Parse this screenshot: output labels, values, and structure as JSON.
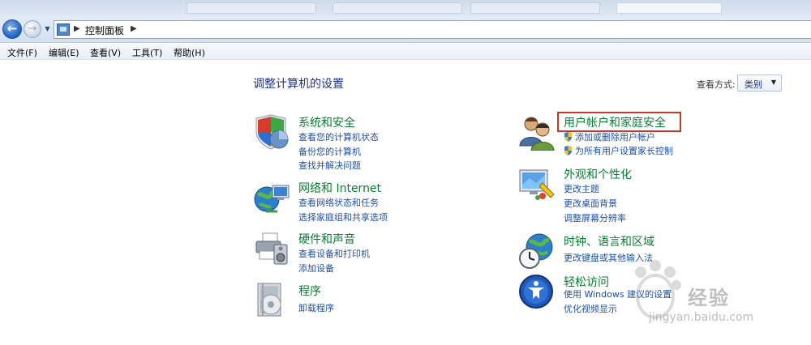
{
  "address": {
    "crumb": "控制面板"
  },
  "menu": {
    "file": "文件(F)",
    "edit": "编辑(E)",
    "view": "查看(V)",
    "tools": "工具(T)",
    "help": "帮助(H)"
  },
  "content": {
    "heading": "调整计算机的设置",
    "viewby_label": "查看方式:",
    "viewby_value": "类别"
  },
  "categories": {
    "system": {
      "title": "系统和安全",
      "links": [
        "查看您的计算机状态",
        "备份您的计算机",
        "查找并解决问题"
      ]
    },
    "network": {
      "title": "网络和 Internet",
      "links": [
        "查看网络状态和任务",
        "选择家庭组和共享选项"
      ]
    },
    "hardware": {
      "title": "硬件和声音",
      "links": [
        "查看设备和打印机",
        "添加设备"
      ]
    },
    "programs": {
      "title": "程序",
      "links": [
        "卸载程序"
      ]
    },
    "users": {
      "title": "用户帐户和家庭安全",
      "links": [
        "添加或删除用户帐户",
        "为所有用户设置家长控制"
      ]
    },
    "appearance": {
      "title": "外观和个性化",
      "links": [
        "更改主题",
        "更改桌面背景",
        "调整屏幕分辨率"
      ]
    },
    "clock": {
      "title": "时钟、语言和区域",
      "links": [
        "更改键盘或其他输入法"
      ]
    },
    "ease": {
      "title": "轻松访问",
      "links": [
        "使用 Windows 建议的设置",
        "优化视频显示"
      ]
    }
  },
  "watermark": {
    "text": "经验",
    "url": "jingyan.baidu.com"
  },
  "colors": {
    "category_title": "#0a7d32",
    "link": "#1e4fa8",
    "highlight": "#c23a2a"
  }
}
